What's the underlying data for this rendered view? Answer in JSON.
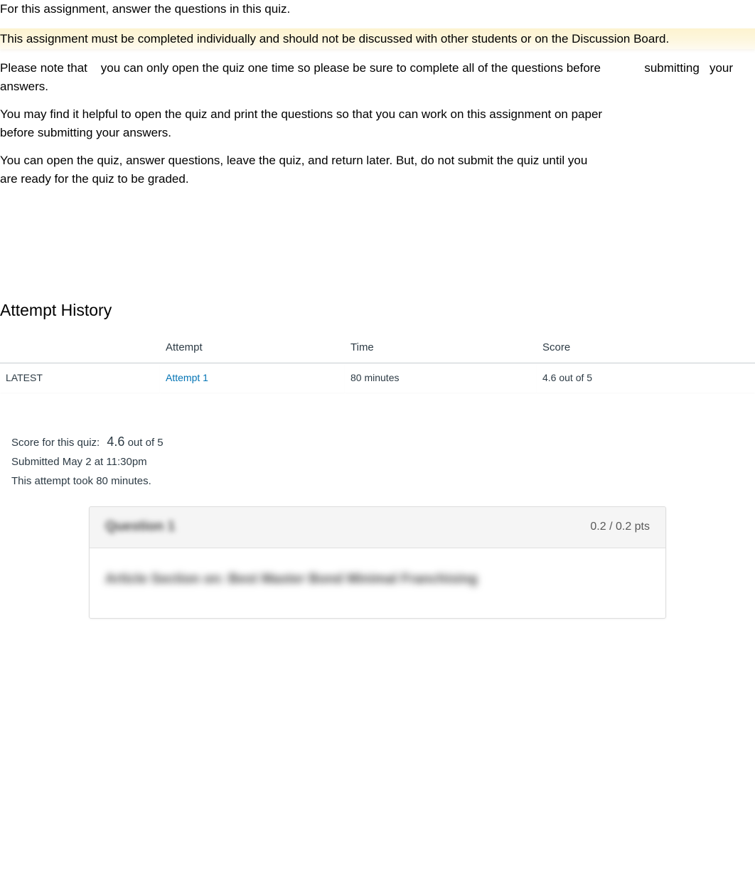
{
  "instructions": {
    "p1": "For this assignment, answer the questions in this quiz.",
    "p2": "This assignment must be completed individually and should not be discussed with other students or on the Discussion Board.",
    "p3_part1": "Please note that",
    "p3_part2": "you can only open the quiz one time so please be sure to complete all of the questions before",
    "p3_part3": "submitting",
    "p3_part4": "your answers.",
    "p4": "You may find it helpful to open the quiz and print the questions so that you can work on this assignment on paper before submitting your answers.",
    "p5": "You can open the quiz, answer questions, leave the quiz, and return later. But, do not submit the quiz until you are ready for the quiz to be graded."
  },
  "history": {
    "heading": "Attempt History",
    "headers": {
      "blank": "",
      "attempt": "Attempt",
      "time": "Time",
      "score": "Score"
    },
    "rows": [
      {
        "latest": "LATEST",
        "attempt": "Attempt 1",
        "time": "80 minutes",
        "score": "4.6 out of 5"
      }
    ]
  },
  "summary": {
    "score_label": "Score for this quiz:",
    "score_value": "4.6",
    "score_suffix": "out of 5",
    "submitted": "Submitted May 2 at 11:30pm",
    "duration": "This attempt took 80 minutes."
  },
  "question": {
    "title_blurred": "Question 1",
    "pts": "0.2 / 0.2 pts",
    "body_blurred": "Article Section on: Best Master Bond Minimal  Franchising"
  }
}
